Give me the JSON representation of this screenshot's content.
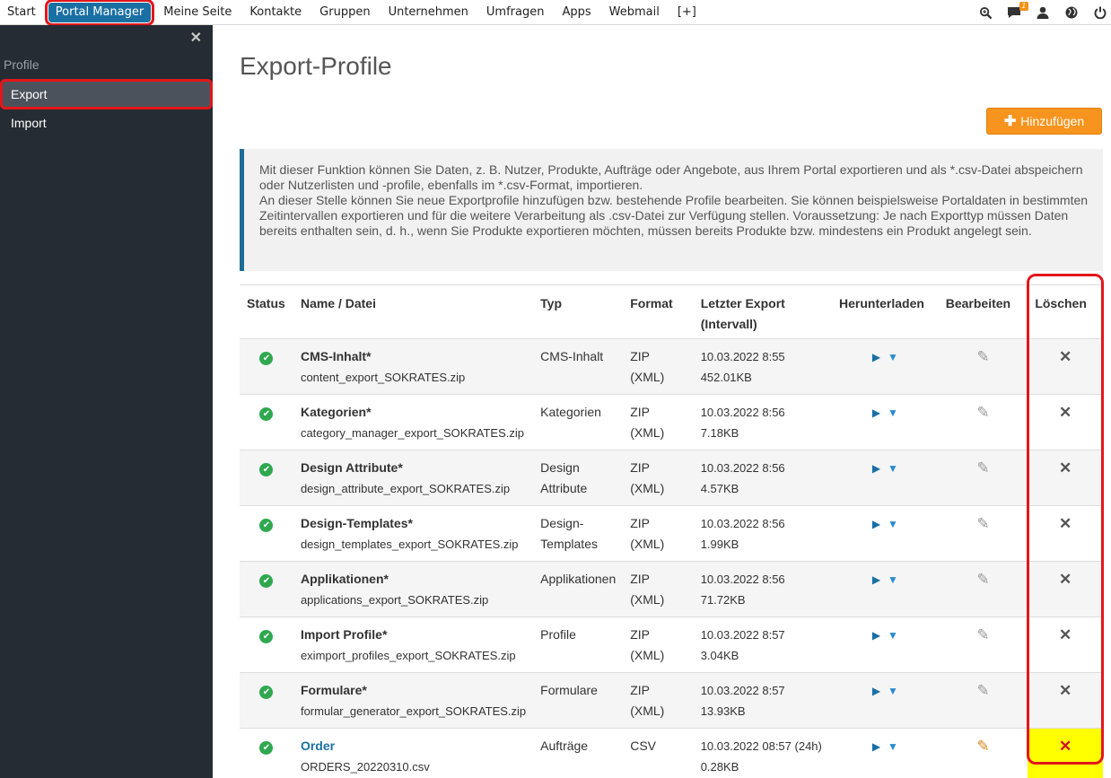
{
  "topnav": {
    "items": [
      {
        "label": "Start",
        "active": false
      },
      {
        "label": "Portal Manager",
        "active": true
      },
      {
        "label": "Meine Seite",
        "active": false
      },
      {
        "label": "Kontakte",
        "active": false
      },
      {
        "label": "Gruppen",
        "active": false
      },
      {
        "label": "Unternehmen",
        "active": false
      },
      {
        "label": "Umfragen",
        "active": false
      },
      {
        "label": "Apps",
        "active": false
      },
      {
        "label": "Webmail",
        "active": false
      },
      {
        "label": "[+]",
        "active": false
      }
    ],
    "notification_count": "1"
  },
  "sidebar": {
    "close_glyph": "✕",
    "section_label": "Profile",
    "items": [
      {
        "label": "Export",
        "active": true
      },
      {
        "label": "Import",
        "active": false
      }
    ]
  },
  "page": {
    "title": "Export-Profile",
    "add_button_label": "Hinzufügen",
    "info_line1": "Mit dieser Funktion können Sie Daten, z. B. Nutzer, Produkte, Aufträge oder Angebote, aus Ihrem Portal exportieren und als *.csv-Datei abspeichern oder Nutzerlisten und -profile, ebenfalls im *.csv-Format, importieren.",
    "info_line2": "An dieser Stelle können Sie neue Exportprofile hinzufügen bzw. bestehende Profile bearbeiten. Sie können beispielsweise Portaldaten in bestimmten Zeitintervallen exportieren und für die weitere Verarbeitung als .csv-Datei zur Verfügung stellen. Voraussetzung: Je nach Exporttyp müssen Daten bereits enthalten sein, d. h., wenn Sie Produkte exportieren möchten, müssen bereits Produkte bzw. mindestens ein Produkt angelegt sein."
  },
  "table": {
    "headers": {
      "status": "Status",
      "name": "Name / Datei",
      "typ": "Typ",
      "format": "Format",
      "letzter_export_1": "Letzter Export",
      "letzter_export_2": "(Intervall)",
      "herunterladen": "Herunterladen",
      "bearbeiten": "Bearbeiten",
      "loeschen": "Löschen"
    },
    "rows": [
      {
        "name": "CMS-Inhalt*",
        "file": "content_export_SOKRATES.zip",
        "typ": "CMS-Inhalt",
        "format": "ZIP (XML)",
        "date": "10.03.2022 8:55",
        "size": "452.01KB"
      },
      {
        "name": "Kategorien*",
        "file": "category_manager_export_SOKRATES.zip",
        "typ": "Kategorien",
        "format": "ZIP (XML)",
        "date": "10.03.2022 8:56",
        "size": "7.18KB"
      },
      {
        "name": "Design Attribute*",
        "file": "design_attribute_export_SOKRATES.zip",
        "typ": "Design Attribute",
        "format": "ZIP (XML)",
        "date": "10.03.2022 8:56",
        "size": "4.57KB"
      },
      {
        "name": "Design-Templates*",
        "file": "design_templates_export_SOKRATES.zip",
        "typ": "Design-Templates",
        "format": "ZIP (XML)",
        "date": "10.03.2022 8:56",
        "size": "1.99KB"
      },
      {
        "name": "Applikationen*",
        "file": "applications_export_SOKRATES.zip",
        "typ": "Applikationen",
        "format": "ZIP (XML)",
        "date": "10.03.2022 8:56",
        "size": "71.72KB"
      },
      {
        "name": "Import Profile*",
        "file": "eximport_profiles_export_SOKRATES.zip",
        "typ": "Profile",
        "format": "ZIP (XML)",
        "date": "10.03.2022 8:57",
        "size": "3.04KB"
      },
      {
        "name": "Formulare*",
        "file": "formular_generator_export_SOKRATES.zip",
        "typ": "Formulare",
        "format": "ZIP (XML)",
        "date": "10.03.2022 8:57",
        "size": "13.93KB"
      },
      {
        "name": "Order",
        "file": "ORDERS_20220310.csv",
        "typ": "Aufträge",
        "format": "CSV",
        "date": "10.03.2022 08:57 (24h)",
        "size": "0.28KB"
      }
    ]
  },
  "icons": {
    "search": "search-icon",
    "chat": "chat-icon",
    "user": "user-icon",
    "globe": "globe-icon",
    "power": "power-icon",
    "status": "check-circle-icon",
    "download_play": "play-icon",
    "download_arrow": "download-icon",
    "edit": "pencil-icon",
    "delete": "delete-icon"
  },
  "colors": {
    "accent": "#1a6fa3",
    "add_button": "#f7941d",
    "sidebar_bg": "#252c34",
    "highlight_outline": "#e3161b",
    "delete_highlight": "#ffff00",
    "status_ok": "#2fa84f"
  }
}
